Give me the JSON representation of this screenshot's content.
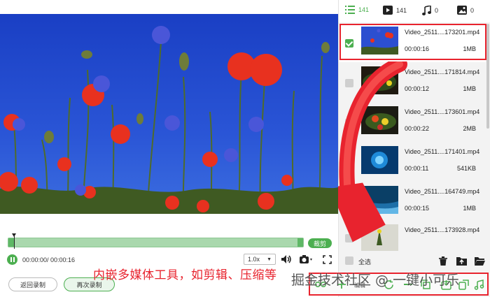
{
  "tabs": [
    {
      "icon": "list-icon",
      "count": "141"
    },
    {
      "icon": "video-icon",
      "count": "141"
    },
    {
      "icon": "music-icon",
      "count": "0"
    },
    {
      "icon": "image-icon",
      "count": "0"
    }
  ],
  "files": [
    {
      "name": "Video_2511....173201.mp4",
      "duration": "00:00:16",
      "size": "1MB",
      "checked": true
    },
    {
      "name": "Video_2511....171814.mp4",
      "duration": "00:00:12",
      "size": "1MB",
      "checked": false
    },
    {
      "name": "Video_2511....173601.mp4",
      "duration": "00:00:22",
      "size": "2MB",
      "checked": false
    },
    {
      "name": "Video_2511....171401.mp4",
      "duration": "00:00:11",
      "size": "541KB",
      "checked": false
    },
    {
      "name": "Video_2511....164749.mp4",
      "duration": "00:00:15",
      "size": "1MB",
      "checked": false
    },
    {
      "name": "Video_2511....173928.mp4",
      "duration": "",
      "size": "",
      "checked": false
    }
  ],
  "player": {
    "cut_label": "裁剪",
    "time": "00:00:00/ 00:00:16",
    "speed": "1.0x"
  },
  "buttons": {
    "back_record": "返回录制",
    "record_again": "再次录制"
  },
  "footer": {
    "select_all": "全选"
  },
  "toolbar": {
    "partial_label": "编辑"
  },
  "annotation": {
    "caption": "内嵌多媒体工具，如剪辑、压缩等",
    "watermark": "掘金技术社区 @ 一键小可乐"
  },
  "colors": {
    "accent": "#4caf50",
    "highlight": "#e8232e"
  }
}
